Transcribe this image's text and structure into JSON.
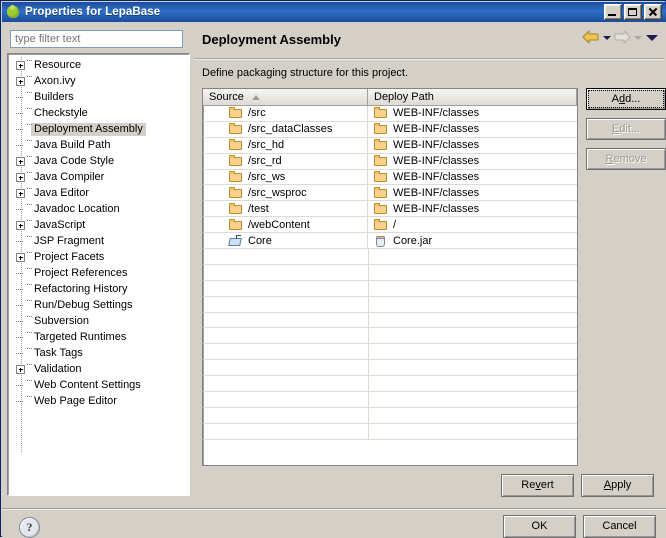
{
  "window": {
    "title": "Properties for LepaBase",
    "icon": "plugin-icon",
    "controls": [
      {
        "name": "minimize-button",
        "glyph": "_"
      },
      {
        "name": "maximize-button",
        "glyph": "□"
      },
      {
        "name": "close-button",
        "glyph": "✕"
      }
    ]
  },
  "sidebar": {
    "filter": {
      "value": "",
      "placeholder": "type filter text"
    },
    "items": [
      {
        "label": "Resource",
        "expandable": true,
        "selected": false
      },
      {
        "label": "Axon.ivy",
        "expandable": true,
        "selected": false
      },
      {
        "label": "Builders",
        "expandable": false,
        "selected": false
      },
      {
        "label": "Checkstyle",
        "expandable": false,
        "selected": false
      },
      {
        "label": "Deployment Assembly",
        "expandable": false,
        "selected": true
      },
      {
        "label": "Java Build Path",
        "expandable": false,
        "selected": false
      },
      {
        "label": "Java Code Style",
        "expandable": true,
        "selected": false
      },
      {
        "label": "Java Compiler",
        "expandable": true,
        "selected": false
      },
      {
        "label": "Java Editor",
        "expandable": true,
        "selected": false
      },
      {
        "label": "Javadoc Location",
        "expandable": false,
        "selected": false
      },
      {
        "label": "JavaScript",
        "expandable": true,
        "selected": false
      },
      {
        "label": "JSP Fragment",
        "expandable": false,
        "selected": false
      },
      {
        "label": "Project Facets",
        "expandable": true,
        "selected": false
      },
      {
        "label": "Project References",
        "expandable": false,
        "selected": false
      },
      {
        "label": "Refactoring History",
        "expandable": false,
        "selected": false
      },
      {
        "label": "Run/Debug Settings",
        "expandable": false,
        "selected": false
      },
      {
        "label": "Subversion",
        "expandable": false,
        "selected": false
      },
      {
        "label": "Targeted Runtimes",
        "expandable": false,
        "selected": false
      },
      {
        "label": "Task Tags",
        "expandable": false,
        "selected": false
      },
      {
        "label": "Validation",
        "expandable": true,
        "selected": false
      },
      {
        "label": "Web Content Settings",
        "expandable": false,
        "selected": false
      },
      {
        "label": "Web Page Editor",
        "expandable": false,
        "selected": false
      }
    ]
  },
  "page": {
    "title": "Deployment Assembly",
    "description": "Define packaging structure for this project.",
    "nav": {
      "back": {
        "name": "back-arrow-icon",
        "enabled": true,
        "color": "#e8b33a"
      },
      "back_menu": {
        "name": "back-dropdown-icon",
        "enabled": true
      },
      "forward": {
        "name": "forward-arrow-icon",
        "enabled": false,
        "color": "#cfcbc4"
      },
      "forward_menu": {
        "name": "forward-dropdown-icon",
        "enabled": false
      },
      "menu": {
        "name": "view-menu-icon",
        "enabled": true
      }
    }
  },
  "table": {
    "columns": [
      {
        "label": "Source",
        "sort": "asc"
      },
      {
        "label": "Deploy Path",
        "sort": null
      }
    ],
    "rows": [
      {
        "source": "/src",
        "source_icon": "folder-icon",
        "deploy": "WEB-INF/classes",
        "deploy_icon": "folder-icon"
      },
      {
        "source": "/src_dataClasses",
        "source_icon": "folder-icon",
        "deploy": "WEB-INF/classes",
        "deploy_icon": "folder-icon"
      },
      {
        "source": "/src_hd",
        "source_icon": "folder-icon",
        "deploy": "WEB-INF/classes",
        "deploy_icon": "folder-icon"
      },
      {
        "source": "/src_rd",
        "source_icon": "folder-icon",
        "deploy": "WEB-INF/classes",
        "deploy_icon": "folder-icon"
      },
      {
        "source": "/src_ws",
        "source_icon": "folder-icon",
        "deploy": "WEB-INF/classes",
        "deploy_icon": "folder-icon"
      },
      {
        "source": "/src_wsproc",
        "source_icon": "folder-icon",
        "deploy": "WEB-INF/classes",
        "deploy_icon": "folder-icon"
      },
      {
        "source": "/test",
        "source_icon": "folder-icon",
        "deploy": "WEB-INF/classes",
        "deploy_icon": "folder-icon"
      },
      {
        "source": "/webContent",
        "source_icon": "folder-icon",
        "deploy": "/",
        "deploy_icon": "folder-icon"
      },
      {
        "source": "Core",
        "source_icon": "project-reference-icon",
        "deploy": "Core.jar",
        "deploy_icon": "jar-icon"
      }
    ],
    "empty_row_count": 12
  },
  "side_buttons": [
    {
      "label": "Add...",
      "name": "add-button",
      "enabled": true,
      "focused": true,
      "mnemonic": "d"
    },
    {
      "label": "Edit...",
      "name": "edit-button",
      "enabled": false,
      "focused": false,
      "mnemonic": "E"
    },
    {
      "label": "Remove",
      "name": "remove-button",
      "enabled": false,
      "focused": false,
      "mnemonic": "R"
    }
  ],
  "apply_buttons": [
    {
      "label": "Revert",
      "name": "revert-button",
      "mnemonic": "v"
    },
    {
      "label": "Apply",
      "name": "apply-button",
      "mnemonic": "A"
    }
  ],
  "footer": {
    "help_icon": "help-question-icon",
    "buttons": [
      {
        "label": "OK",
        "name": "ok-button"
      },
      {
        "label": "Cancel",
        "name": "cancel-button"
      }
    ]
  }
}
